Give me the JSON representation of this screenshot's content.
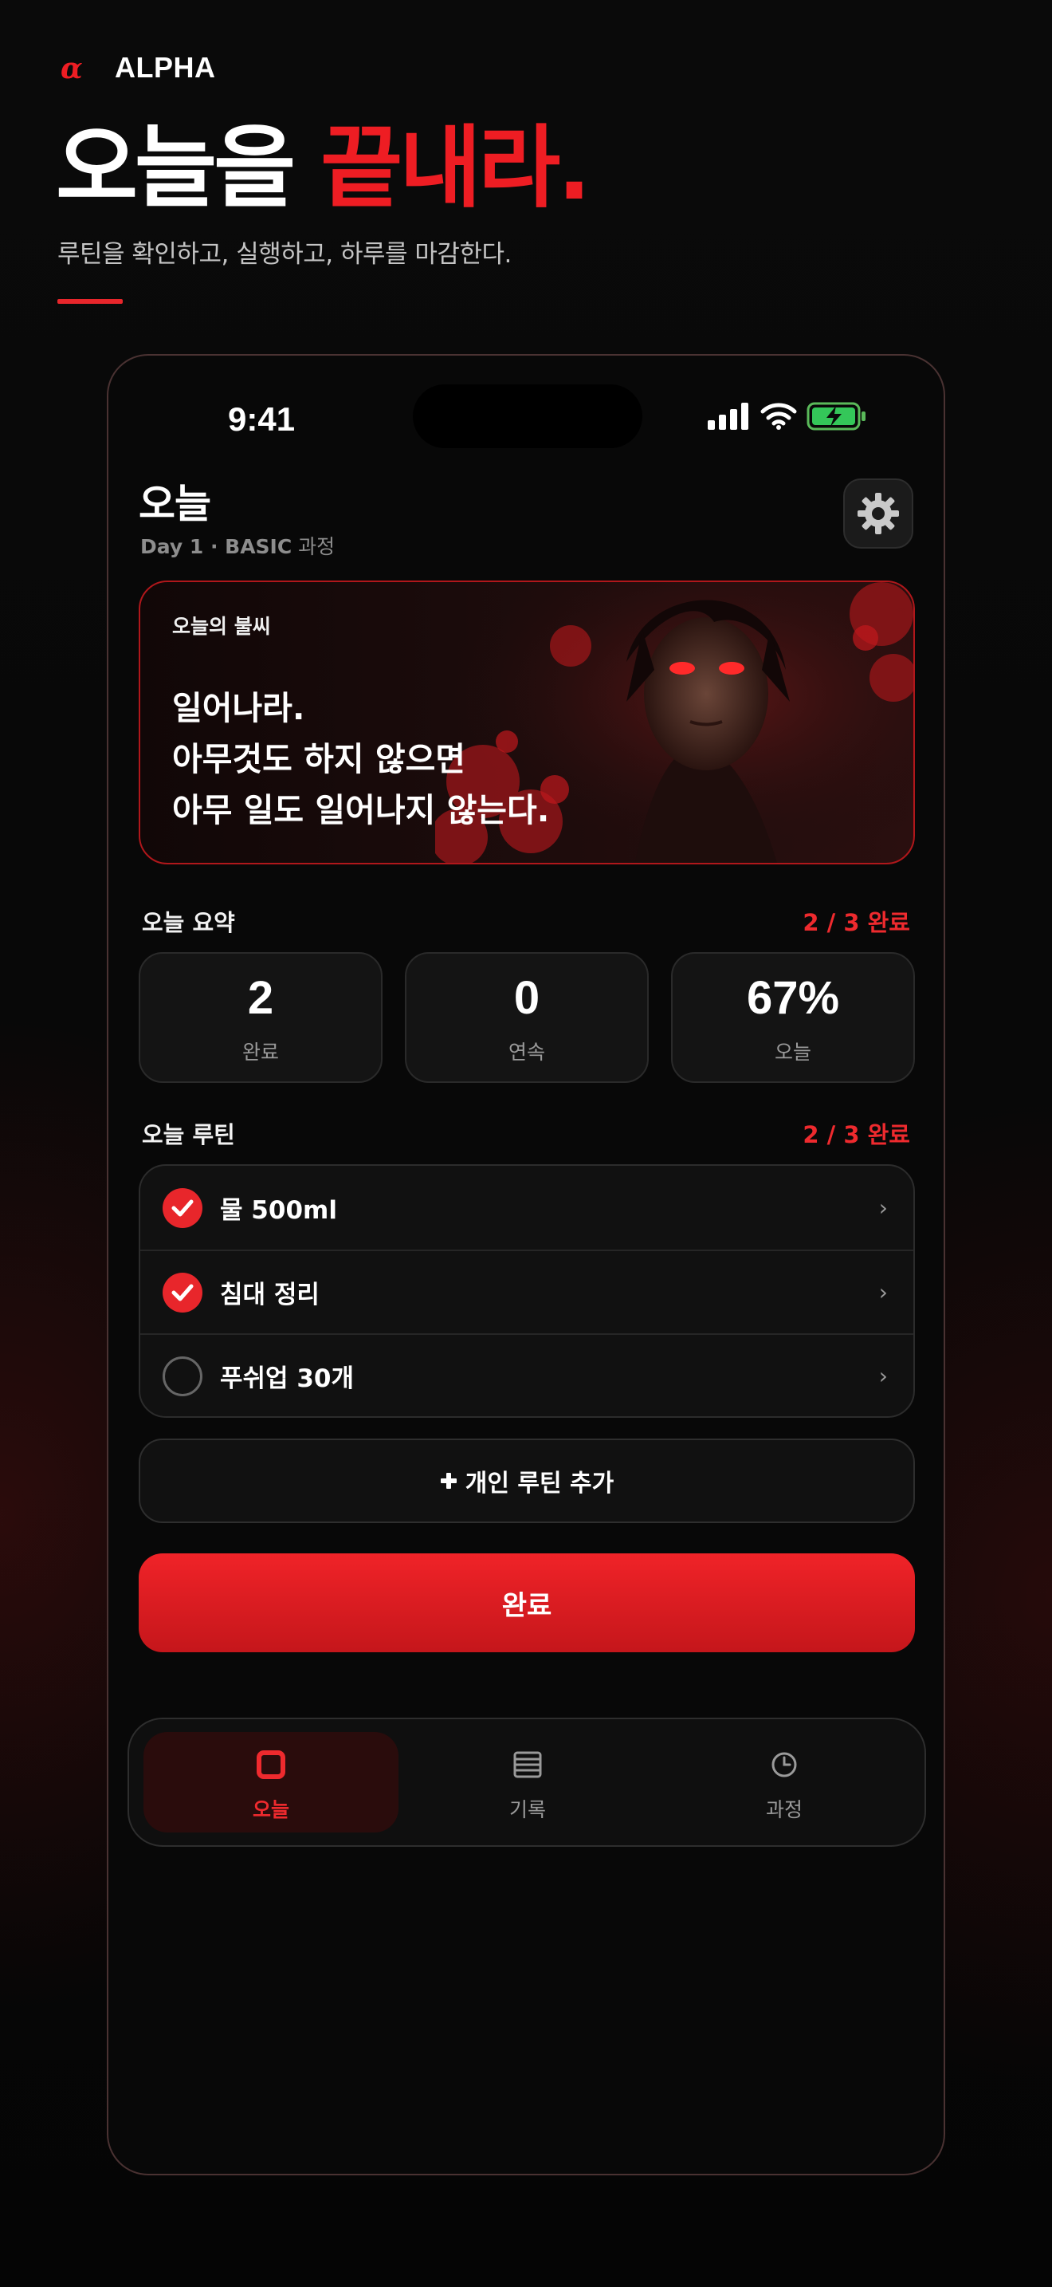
{
  "brand": {
    "name": "ALPHA",
    "logo_icon": "alpha-logo-icon"
  },
  "headline": {
    "part1": "오늘을 ",
    "part2": "끝내라."
  },
  "subline": "루틴을 확인하고, 실행하고, 하루를 마감한다.",
  "colors": {
    "accent": "#ee1d23",
    "background": "#070707",
    "card": "#141414"
  },
  "status_bar": {
    "time": "9:41",
    "icons": [
      "signal-icon",
      "wifi-icon",
      "battery-charging-icon"
    ]
  },
  "screen": {
    "title": "오늘",
    "subtitle_bold": "Day 1 · BASIC",
    "subtitle_rest": " 과정",
    "settings_icon": "gear-icon"
  },
  "hero": {
    "label": "오늘의 불씨",
    "lines": [
      "일어나라.",
      "아무것도 하지 않으면",
      "아무 일도 일어나지 않는다."
    ]
  },
  "summary": {
    "title": "오늘 요약",
    "count": "2 / 3 완료",
    "stats": [
      {
        "value": "2",
        "label": "완료"
      },
      {
        "value": "0",
        "label": "연속"
      },
      {
        "value": "67%",
        "label": "오늘"
      }
    ]
  },
  "routines": {
    "title": "오늘 루틴",
    "count": "2 / 3 완료",
    "items": [
      {
        "label": "물 500ml",
        "done": true
      },
      {
        "label": "침대 정리",
        "done": true
      },
      {
        "label": "푸쉬업 30개",
        "done": false
      }
    ],
    "chevron": "›"
  },
  "add_button": {
    "icon": "plus-icon",
    "label": "개인 루틴 추가"
  },
  "done_button": {
    "label": "완료"
  },
  "tabs": [
    {
      "label": "오늘",
      "icon": "square-icon",
      "active": true
    },
    {
      "label": "기록",
      "icon": "list-icon",
      "active": false
    },
    {
      "label": "과정",
      "icon": "clock-icon",
      "active": false
    }
  ]
}
